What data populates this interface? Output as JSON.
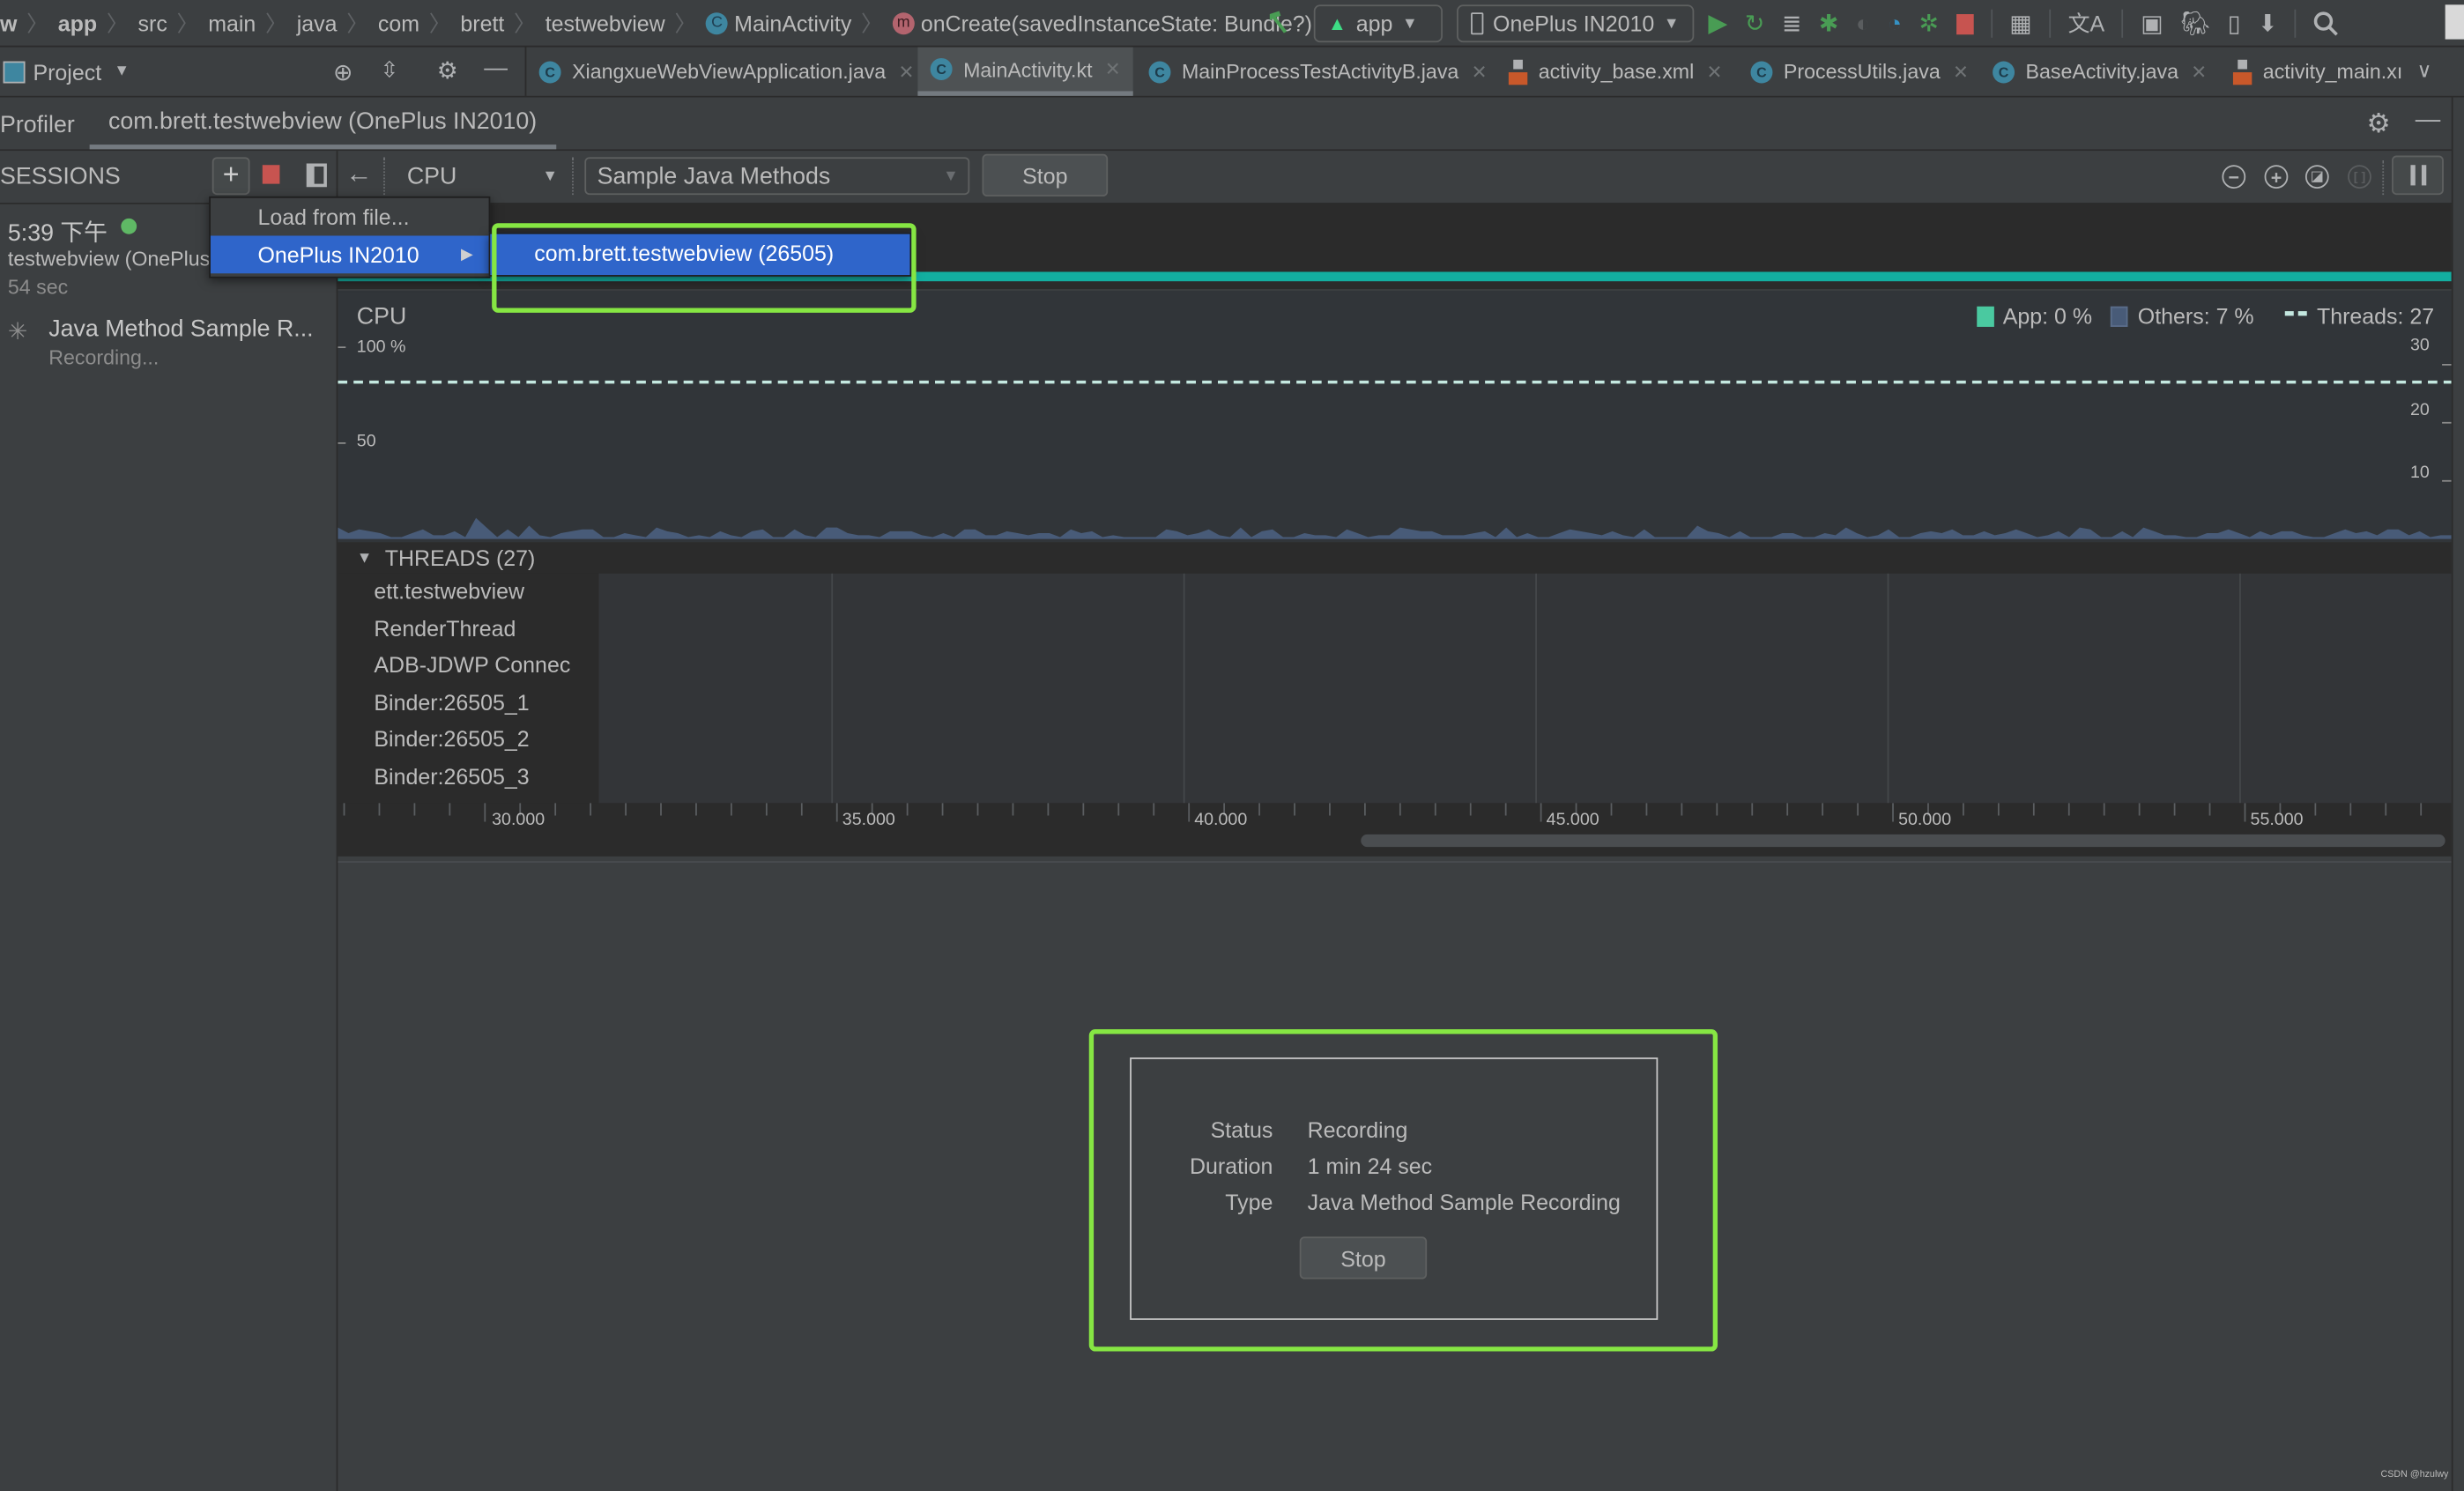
{
  "navbar": {
    "breadcrumbs": [
      "w",
      "app",
      "src",
      "main",
      "java",
      "com",
      "brett",
      "testwebview",
      "MainActivity",
      "onCreate(savedInstanceState: Bundle?)"
    ],
    "run_config": "app",
    "device": "OnePlus IN2010"
  },
  "project_panel": {
    "title": "Project"
  },
  "editor_tabs": [
    {
      "label": "XiangxueWebViewApplication.java",
      "icon": "java-class-icon",
      "active": false
    },
    {
      "label": "MainActivity.kt",
      "icon": "kotlin-class-icon",
      "active": true
    },
    {
      "label": "MainProcessTestActivityB.java",
      "icon": "java-class-icon",
      "active": false
    },
    {
      "label": "activity_base.xml",
      "icon": "xml-layout-icon",
      "active": false
    },
    {
      "label": "ProcessUtils.java",
      "icon": "java-class-icon",
      "active": false
    },
    {
      "label": "BaseActivity.java",
      "icon": "java-class-icon",
      "active": false
    },
    {
      "label": "activity_main.xı",
      "icon": "xml-layout-icon",
      "active": false
    }
  ],
  "profiler": {
    "tool_title": "Profiler",
    "session_tab": "com.brett.testwebview (OnePlus IN2010)",
    "sessions_label": "SESSIONS",
    "monitor_select": "CPU",
    "config_select": "Sample Java Methods",
    "stop_label": "Stop"
  },
  "add_session_menu": {
    "items": [
      "Load from file...",
      "OnePlus IN2010"
    ],
    "submenu_items": [
      "com.brett.testwebview (26505)"
    ]
  },
  "session": {
    "time": "5:39 下午",
    "name": "testwebview (OnePlus",
    "duration": "54 sec",
    "recording_title": "Java Method Sample R...",
    "recording_status": "Recording..."
  },
  "cpu_chart": {
    "title": "CPU",
    "legend": {
      "app": "App: 0 %",
      "others": "Others: 7 %",
      "threads": "Threads: 27"
    },
    "colors": {
      "app": "#4ac9a0",
      "others": "#485b78",
      "threads": "#c4e8e0",
      "band": "#13aea0",
      "highlight": "#86e643",
      "menu_selected": "#2f65ca"
    }
  },
  "chart_data": {
    "type": "area",
    "title": "CPU",
    "left_axis": {
      "ticks": [
        "100 %",
        "50"
      ],
      "range": [
        0,
        100
      ],
      "unit": "%"
    },
    "right_axis": {
      "ticks": [
        "30",
        "20",
        "10"
      ],
      "range": [
        0,
        33
      ]
    },
    "threads_line": 27,
    "series": [
      {
        "name": "Others",
        "values": [
          6,
          3,
          5,
          4,
          3,
          1,
          1,
          3,
          5,
          2,
          2,
          4,
          1,
          11,
          6,
          1,
          5,
          1,
          7,
          2,
          1,
          3,
          4,
          5,
          5,
          1,
          1,
          3,
          2,
          1,
          6,
          4,
          3,
          1,
          2,
          1,
          4,
          2,
          1,
          4,
          5,
          1,
          1,
          5,
          2,
          1,
          6,
          6,
          3,
          2,
          2,
          1,
          4,
          4,
          4,
          2,
          1,
          3,
          1,
          5,
          5,
          2,
          2,
          4,
          3,
          2,
          3,
          3,
          1,
          5,
          3,
          4,
          1,
          2,
          1,
          1,
          1,
          1,
          5,
          4,
          2,
          3,
          5,
          2,
          1,
          6,
          1,
          4,
          5,
          1,
          1,
          3,
          2,
          2,
          1,
          5,
          3,
          1,
          2,
          2,
          6,
          5,
          4,
          4,
          2,
          2,
          2,
          3,
          4,
          1,
          6,
          1,
          3,
          1,
          1,
          3,
          5,
          4,
          3,
          2,
          4,
          2,
          1,
          5,
          1,
          1,
          1,
          1,
          7,
          4,
          3,
          1,
          4,
          1,
          1,
          1,
          3,
          3,
          1,
          1,
          3,
          2,
          6,
          3,
          1,
          2,
          5,
          1,
          1,
          3,
          4,
          3,
          5,
          2,
          2,
          4,
          2,
          3,
          5,
          3,
          1,
          2,
          4,
          1,
          6,
          5,
          1,
          1,
          4,
          1,
          6,
          4,
          2,
          2,
          1,
          1,
          3,
          3,
          5,
          3,
          1,
          4,
          2,
          4,
          4,
          2,
          1,
          1,
          3,
          5,
          3,
          4,
          2,
          5,
          5,
          2,
          4,
          1,
          2,
          2
        ],
        "approx": true
      },
      {
        "name": "App",
        "values": [
          0
        ]
      }
    ]
  },
  "threads": {
    "header": "THREADS (27)",
    "names": [
      "ett.testwebview",
      "RenderThread",
      "ADB-JDWP Connec",
      "Binder:26505_1",
      "Binder:26505_2",
      "Binder:26505_3"
    ]
  },
  "time_axis": {
    "ticks": [
      "30.000",
      "35.000",
      "40.000",
      "45.000",
      "50.000",
      "55.000"
    ]
  },
  "recording_panel": {
    "rows": [
      {
        "label": "Status",
        "value": "Recording"
      },
      {
        "label": "Duration",
        "value": "1 min 24 sec"
      },
      {
        "label": "Type",
        "value": "Java Method Sample Recording"
      }
    ],
    "stop_label": "Stop"
  },
  "watermark": "CSDN @hzulwy"
}
